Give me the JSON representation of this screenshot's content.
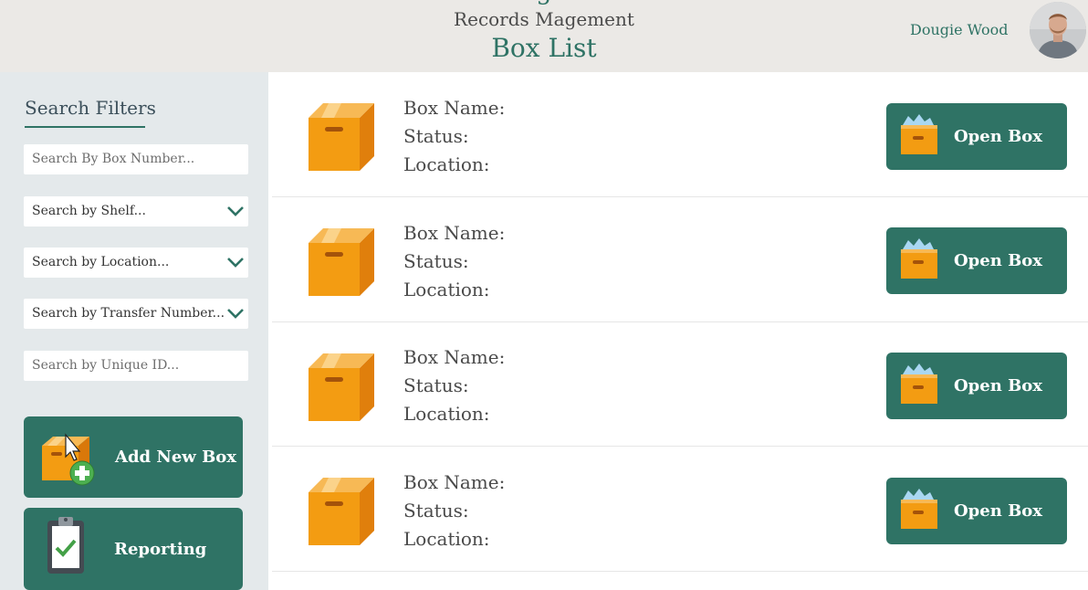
{
  "header": {
    "partial_title": "g",
    "app_title": "Records Magement",
    "page_title": "Box List",
    "username": "Dougie Wood"
  },
  "sidebar": {
    "filters_title": "Search Filters",
    "fields": {
      "box_number_placeholder": "Search By Box Number...",
      "shelf_placeholder": "Search by Shelf...",
      "location_placeholder": "Search by Location...",
      "transfer_placeholder": "Search by Transfer Number...",
      "unique_id_placeholder": "Search by Unique ID..."
    },
    "add_box_label": "Add New Box",
    "reporting_label": "Reporting"
  },
  "boxes": [
    {
      "name_label": "Box Name:",
      "status_label": "Status:",
      "location_label": "Location:",
      "open_label": "Open Box"
    },
    {
      "name_label": "Box Name:",
      "status_label": "Status:",
      "location_label": "Location:",
      "open_label": "Open Box"
    },
    {
      "name_label": "Box Name:",
      "status_label": "Status:",
      "location_label": "Location:",
      "open_label": "Open Box"
    },
    {
      "name_label": "Box Name:",
      "status_label": "Status:",
      "location_label": "Location:",
      "open_label": "Open Box"
    }
  ],
  "colors": {
    "accent": "#2f7365",
    "header_bg": "#ebe9e6",
    "sidebar_bg": "#e4e9eb",
    "box_orange": "#f39c12"
  },
  "icons": {
    "box": "cardboard-box-icon",
    "open_box": "open-box-icon",
    "add_box": "add-box-icon",
    "reporting": "clipboard-check-icon",
    "chevron": "chevron-down-icon"
  }
}
